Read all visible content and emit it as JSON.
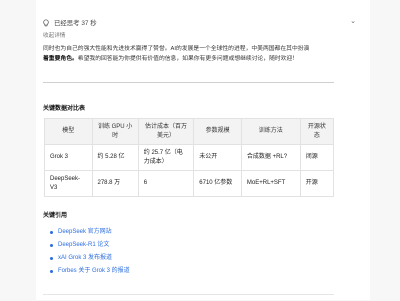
{
  "thinking": {
    "label": "已经思考 37 秒",
    "collapse_label": "收起详情"
  },
  "summary": {
    "line1": "同时也为自己的强大性能和先进技术赢得了赞誉。AI的发展是一个全球性的进程，中美两国都在其中扮演",
    "line2_bold": "着重要角色。",
    "line2_rest": "希望我的回答能为你提供有价值的信息，如果你有更多问题或想继续讨论，随时欢迎！"
  },
  "comparison": {
    "title": "关键数据对比表",
    "headers": [
      "模型",
      "训练 GPU 小时",
      "估计成本（百万美元）",
      "参数规模",
      "训练方法",
      "开源状态"
    ],
    "rows": [
      [
        "Grok 3",
        "约 5.28 亿",
        "约 25.7 亿（电力成本）",
        "未公开",
        "合成数据 +RL?",
        "闭源"
      ],
      [
        "DeepSeek-V3",
        "278.8 万",
        "6",
        "6710 亿参数",
        "MoE+RL+SFT",
        "开源"
      ]
    ]
  },
  "references": {
    "title": "关键引用",
    "items": [
      "DeepSeek 官方网站",
      "DeepSeek-R1 论文",
      "xAI Grok 3 发布报道",
      "Forbes 关于 Grok 3 的报道"
    ]
  }
}
